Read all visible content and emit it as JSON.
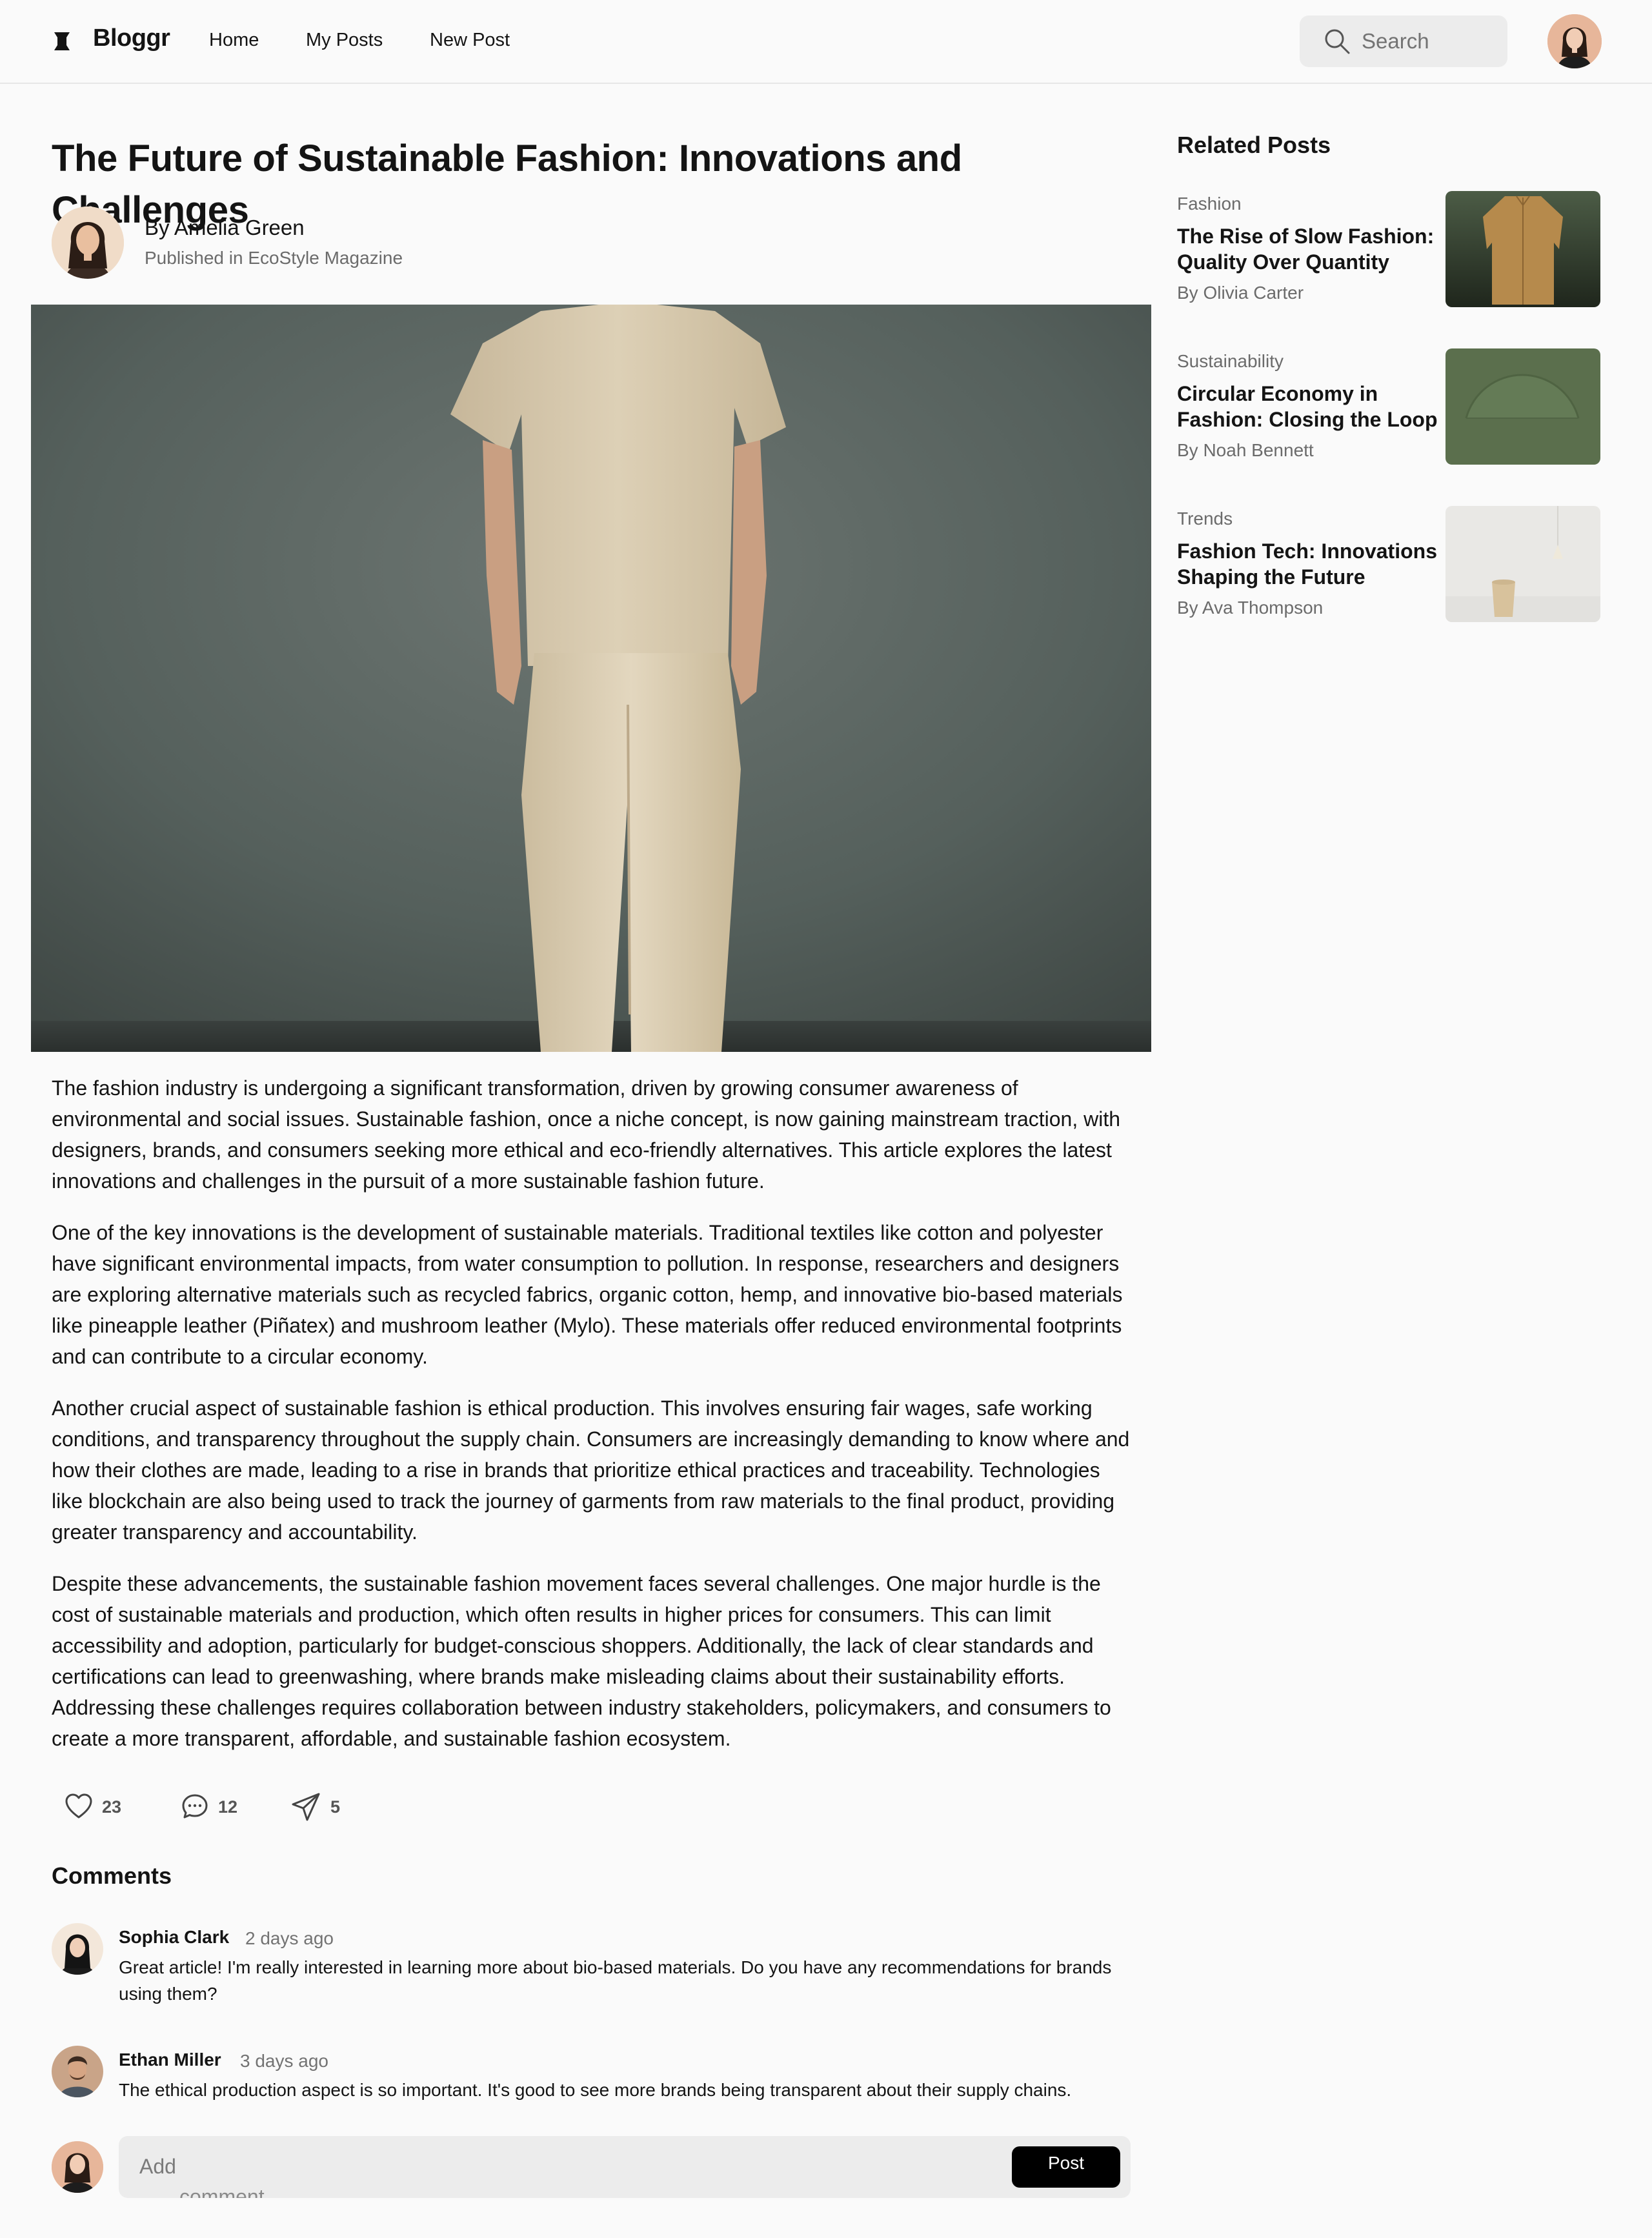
{
  "header": {
    "logo_text": "Bloggr",
    "nav": [
      "Home",
      "My Posts",
      "New Post"
    ],
    "search_placeholder": "Search"
  },
  "article": {
    "title": "The Future of Sustainable Fashion: Innovations and Challenges",
    "author": "By Amelia Green",
    "publication": "Published in EcoStyle Magazine",
    "paragraphs": [
      "The fashion industry is undergoing a significant transformation, driven by growing consumer awareness of environmental and social issues. Sustainable fashion, once a niche concept, is now gaining mainstream traction, with designers, brands, and consumers seeking more ethical and eco-friendly alternatives. This article explores the latest innovations and challenges in the pursuit of a more sustainable fashion future.",
      "One of the key innovations is the development of sustainable materials. Traditional textiles like cotton and polyester have significant environmental impacts, from water consumption to pollution. In response, researchers and designers are exploring alternative materials such as recycled fabrics, organic cotton, hemp, and innovative bio-based materials like pineapple leather (Piñatex) and mushroom leather (Mylo). These materials offer reduced environmental footprints and can contribute to a circular economy.",
      "Another crucial aspect of sustainable fashion is ethical production. This involves ensuring fair wages, safe working conditions, and transparency throughout the supply chain. Consumers are increasingly demanding to know where and how their clothes are made, leading to a rise in brands that prioritize ethical practices and traceability. Technologies like blockchain are also being used to track the journey of garments from raw materials to the final product, providing greater transparency and accountability.",
      "Despite these advancements, the sustainable fashion movement faces several challenges. One major hurdle is the cost of sustainable materials and production, which often results in higher prices for consumers. This can limit accessibility and adoption, particularly for budget-conscious shoppers. Additionally, the lack of clear standards and certifications can lead to greenwashing, where brands make misleading claims about their sustainability efforts. Addressing these challenges requires collaboration between industry stakeholders, policymakers, and consumers to create a more transparent, affordable, and sustainable fashion ecosystem."
    ],
    "likes": "23",
    "comments_count": "12",
    "shares": "5"
  },
  "comments": {
    "title": "Comments",
    "items": [
      {
        "name": "Sophia Clark",
        "time": "2 days ago",
        "text": "Great article! I'm really interested in learning more about bio-based materials. Do you have any recommendations for brands using them?"
      },
      {
        "name": "Ethan Miller",
        "time": "3 days ago",
        "text": "The ethical production aspect is so important. It's good to see more brands being transparent about their supply chains."
      }
    ],
    "add_placeholder": "Add",
    "add_placeholder_overflow": "comment",
    "post_label": "Post"
  },
  "related": {
    "title": "Related Posts",
    "items": [
      {
        "category": "Fashion",
        "title": "The Rise of Slow Fashion: Quality Over Quantity",
        "author": "By Olivia Carter"
      },
      {
        "category": "Sustainability",
        "title": "Circular Economy in Fashion: Closing the Loop",
        "author": "By Noah Bennett"
      },
      {
        "category": "Trends",
        "title": "Fashion Tech: Innovations Shaping the Future",
        "author": "By Ava Thompson"
      }
    ]
  },
  "colors": {
    "background": "#fafafa",
    "search_bg": "#ececec",
    "post_button": "#000000",
    "muted_text": "#6b6b6b"
  },
  "icons": [
    "logo-icon",
    "search-icon",
    "heart-icon",
    "comment-icon",
    "share-icon"
  ]
}
